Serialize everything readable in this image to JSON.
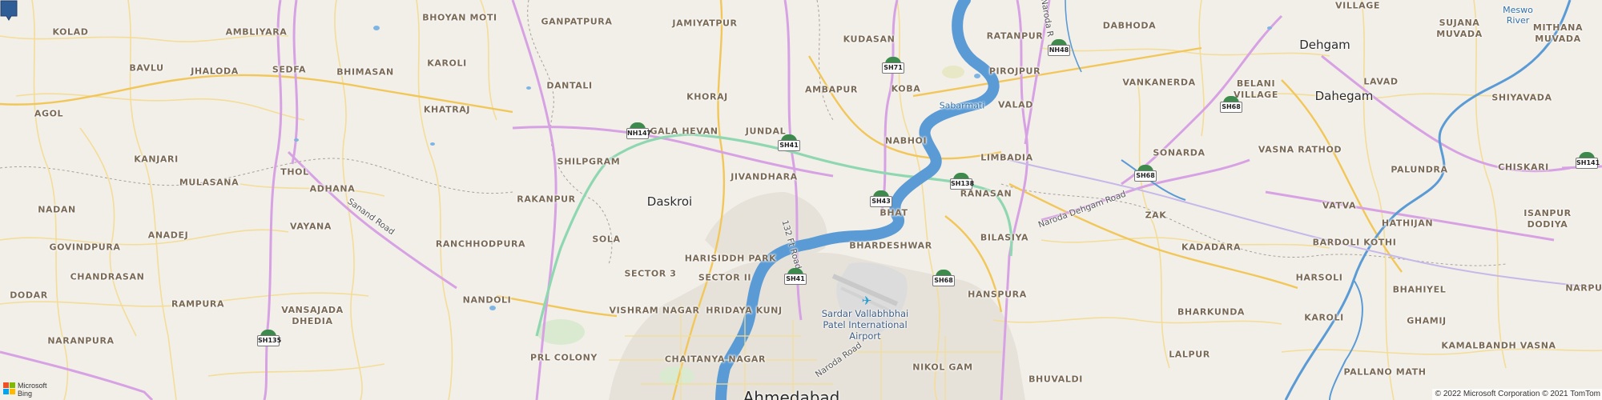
{
  "map": {
    "provider": "Microsoft Bing",
    "copyright": "© 2022 Microsoft Corporation © 2021 TomTom",
    "logo_text_line1": "Microsoft",
    "logo_text_line2": "Bing",
    "colors": {
      "land": "#f2efe9",
      "water": "#5b9bd5",
      "river_urban": "#4a89c8",
      "highway": "#d9a6e6",
      "major_road": "#f5cf67",
      "minor_road": "#f5e19a",
      "green_road": "#8fd6b0",
      "urban": "#e3dfd8",
      "pin": "#2f5d95",
      "shield_green": "#3d8a4d"
    }
  },
  "places": [
    {
      "name": "KOLAD"
    },
    {
      "name": "AMBLIYARA"
    },
    {
      "name": "BHOYAN MOTI"
    },
    {
      "name": "GANPATPURA"
    },
    {
      "name": "JAMIYATPUR"
    },
    {
      "name": "KUDASAN"
    },
    {
      "name": "RATANPUR"
    },
    {
      "name": "DABHODA"
    },
    {
      "name": "VILLAGE"
    },
    {
      "name": "SUJANA MUVADA"
    },
    {
      "name": "MITHANA MUVADA"
    },
    {
      "name": "BAVLU"
    },
    {
      "name": "JHALODA"
    },
    {
      "name": "SEDFA"
    },
    {
      "name": "KAROLI"
    },
    {
      "name": "BHIMASAN"
    },
    {
      "name": "DANTALI"
    },
    {
      "name": "AMBAPUR"
    },
    {
      "name": "KOBA"
    },
    {
      "name": "PIROJPUR"
    },
    {
      "name": "VANKANERDA"
    },
    {
      "name": "BELANI VILLAGE"
    },
    {
      "name": "LAVAD"
    },
    {
      "name": "SHIYAVADA"
    },
    {
      "name": "AGOL"
    },
    {
      "name": "KHATRAJ"
    },
    {
      "name": "KHORAJ"
    },
    {
      "name": "VALAD"
    },
    {
      "name": "GALA HEVAN"
    },
    {
      "name": "JUNDAL"
    },
    {
      "name": "NABHOI"
    },
    {
      "name": "THOL"
    },
    {
      "name": "SHILPGRAM"
    },
    {
      "name": "SONARDA"
    },
    {
      "name": "LIMBADIA"
    },
    {
      "name": "VASNA RATHOD"
    },
    {
      "name": "PALUNDRA"
    },
    {
      "name": "CHISKARI"
    },
    {
      "name": "KANJARI"
    },
    {
      "name": "MULASANA"
    },
    {
      "name": "JIVANDHARA"
    },
    {
      "name": "ADHANA"
    },
    {
      "name": "RAKANPUR"
    },
    {
      "name": "RANASAN"
    },
    {
      "name": "BHAT"
    },
    {
      "name": "NADAN"
    },
    {
      "name": "VAYANA"
    },
    {
      "name": "ZAK"
    },
    {
      "name": "VATVA"
    },
    {
      "name": "ISANPUR DODIYA"
    },
    {
      "name": "HATHIJAN"
    },
    {
      "name": "ANADEJ"
    },
    {
      "name": "SOLA"
    },
    {
      "name": "BILASIYA"
    },
    {
      "name": "GOVINDPURA"
    },
    {
      "name": "RANCHHODPURA"
    },
    {
      "name": "BHARDESHWAR"
    },
    {
      "name": "KADADARA"
    },
    {
      "name": "BARDOLI KOTHI"
    },
    {
      "name": "HARISIDDH PARK"
    },
    {
      "name": "CHANDRASAN"
    },
    {
      "name": "SECTOR 3"
    },
    {
      "name": "SECTOR II"
    },
    {
      "name": "HARSOLI"
    },
    {
      "name": "BHAHIYEL"
    },
    {
      "name": "DODAR"
    },
    {
      "name": "RAMPURA"
    },
    {
      "name": "NANDOLI"
    },
    {
      "name": "HANSPURA"
    },
    {
      "name": "BHARKUNDA"
    },
    {
      "name": "VISHRAM NAGAR"
    },
    {
      "name": "HRIDAYA KUNJ"
    },
    {
      "name": "KAROLI"
    },
    {
      "name": "GHAMIJ"
    },
    {
      "name": "VANSAJADA DHEDIA"
    },
    {
      "name": "NARANPURA"
    },
    {
      "name": "KAMALBANDH VASNA"
    },
    {
      "name": "PRL COLONY"
    },
    {
      "name": "CHAITANYA NAGAR"
    },
    {
      "name": "NIKOL GAM"
    },
    {
      "name": "LALPUR"
    },
    {
      "name": "PALLANO MATH"
    },
    {
      "name": "BHUVALDI"
    },
    {
      "name": "NARPUR"
    }
  ],
  "major_places": [
    {
      "name": "Dehgam"
    },
    {
      "name": "Dahegam"
    },
    {
      "name": "Daskroi"
    }
  ],
  "city": {
    "name": "Ahmedabad"
  },
  "water_labels": [
    {
      "name": "Sabarmati"
    },
    {
      "name": "Meswo River"
    }
  ],
  "airport": {
    "line1": "Sardar Vallabhbhai",
    "line2": "Patel International",
    "line3": "Airport",
    "icon": "airplane-icon"
  },
  "road_labels": [
    {
      "name": "Sanand Road"
    },
    {
      "name": "132 Ft Road"
    },
    {
      "name": "Naroda Road"
    },
    {
      "name": "Naroda Dehgam Road"
    },
    {
      "name": "Naroda R"
    }
  ],
  "shields": [
    {
      "code": "SH71"
    },
    {
      "code": "NH48"
    },
    {
      "code": "NH147"
    },
    {
      "code": "SH41"
    },
    {
      "code": "SH68"
    },
    {
      "code": "SH43"
    },
    {
      "code": "SH138"
    },
    {
      "code": "SH68"
    },
    {
      "code": "SH141"
    },
    {
      "code": "SH41"
    },
    {
      "code": "SH68"
    },
    {
      "code": "SH135"
    }
  ],
  "pin": {
    "icon": "location-pin-icon"
  }
}
